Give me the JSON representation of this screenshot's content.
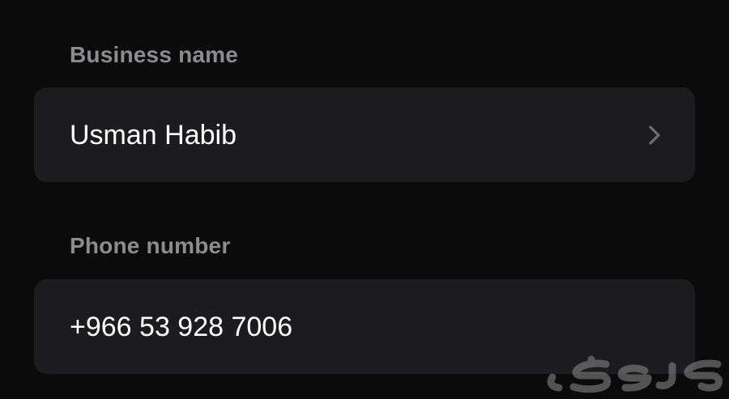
{
  "business": {
    "label": "Business name",
    "value": "Usman Habib",
    "icon": "chevron-right-icon"
  },
  "phone": {
    "label": "Phone number",
    "value": "+966 53 928 7006"
  },
  "watermark": {
    "text": "حراج"
  },
  "colors": {
    "background": "#0b0b0b",
    "card": "#1c1c1e",
    "label": "#8c8c8f",
    "value": "#ffffff",
    "chevron": "#6e6e73"
  }
}
